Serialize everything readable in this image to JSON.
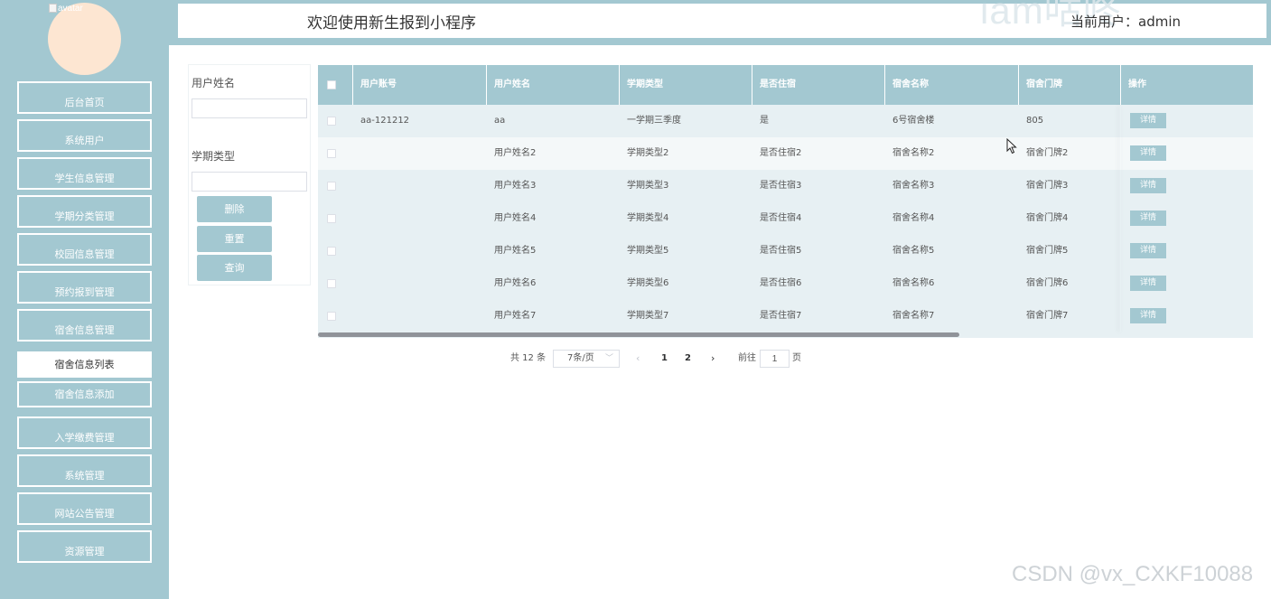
{
  "sidebar": {
    "avatar_alt": "avatar",
    "items": [
      {
        "label": "后台首页"
      },
      {
        "label": "系统用户"
      },
      {
        "label": "学生信息管理"
      },
      {
        "label": "学期分类管理"
      },
      {
        "label": "校园信息管理"
      },
      {
        "label": "预约报到管理"
      },
      {
        "label": "宿舍信息管理"
      }
    ],
    "submenu": [
      {
        "label": "宿舍信息列表"
      },
      {
        "label": "宿舍信息添加"
      }
    ],
    "items_after": [
      {
        "label": "入学缴费管理"
      },
      {
        "label": "系统管理"
      },
      {
        "label": "网站公告管理"
      },
      {
        "label": "资源管理"
      }
    ]
  },
  "header": {
    "title": "欢迎使用新生报到小程序",
    "current_user": "当前用户：admin",
    "watermark": "iam咕咚"
  },
  "search": {
    "username_label": "用户姓名",
    "username_value": "",
    "term_label": "学期类型",
    "term_value": "",
    "delete_label": "删除",
    "reset_label": "重置",
    "query_label": "查询"
  },
  "table": {
    "columns": [
      "用户账号",
      "用户姓名",
      "学期类型",
      "是否住宿",
      "宿舍名称",
      "宿舍门牌",
      "操作"
    ],
    "detail_label": "详情",
    "rows": [
      [
        "aa-121212",
        "aa",
        "一学期三季度",
        "是",
        "6号宿舍楼",
        "805"
      ],
      [
        "",
        "用户姓名2",
        "学期类型2",
        "是否住宿2",
        "宿舍名称2",
        "宿舍门牌2"
      ],
      [
        "",
        "用户姓名3",
        "学期类型3",
        "是否住宿3",
        "宿舍名称3",
        "宿舍门牌3"
      ],
      [
        "",
        "用户姓名4",
        "学期类型4",
        "是否住宿4",
        "宿舍名称4",
        "宿舍门牌4"
      ],
      [
        "",
        "用户姓名5",
        "学期类型5",
        "是否住宿5",
        "宿舍名称5",
        "宿舍门牌5"
      ],
      [
        "",
        "用户姓名6",
        "学期类型6",
        "是否住宿6",
        "宿舍名称6",
        "宿舍门牌6"
      ],
      [
        "",
        "用户姓名7",
        "学期类型7",
        "是否住宿7",
        "宿舍名称7",
        "宿舍门牌7"
      ]
    ]
  },
  "pagination": {
    "total": "共 12 条",
    "page_size": "7条/页",
    "prev": "‹",
    "pages": [
      "1",
      "2"
    ],
    "next": "›",
    "goto_prefix": "前往",
    "goto_value": "1",
    "goto_suffix": "页"
  },
  "watermark_bottom": "CSDN @vx_CXKF10088",
  "colors": {
    "accent": "#a3c8d1",
    "avatar": "#fde6d2",
    "row_even": "#e7f0f3",
    "row_odd": "#f4f8f9"
  }
}
